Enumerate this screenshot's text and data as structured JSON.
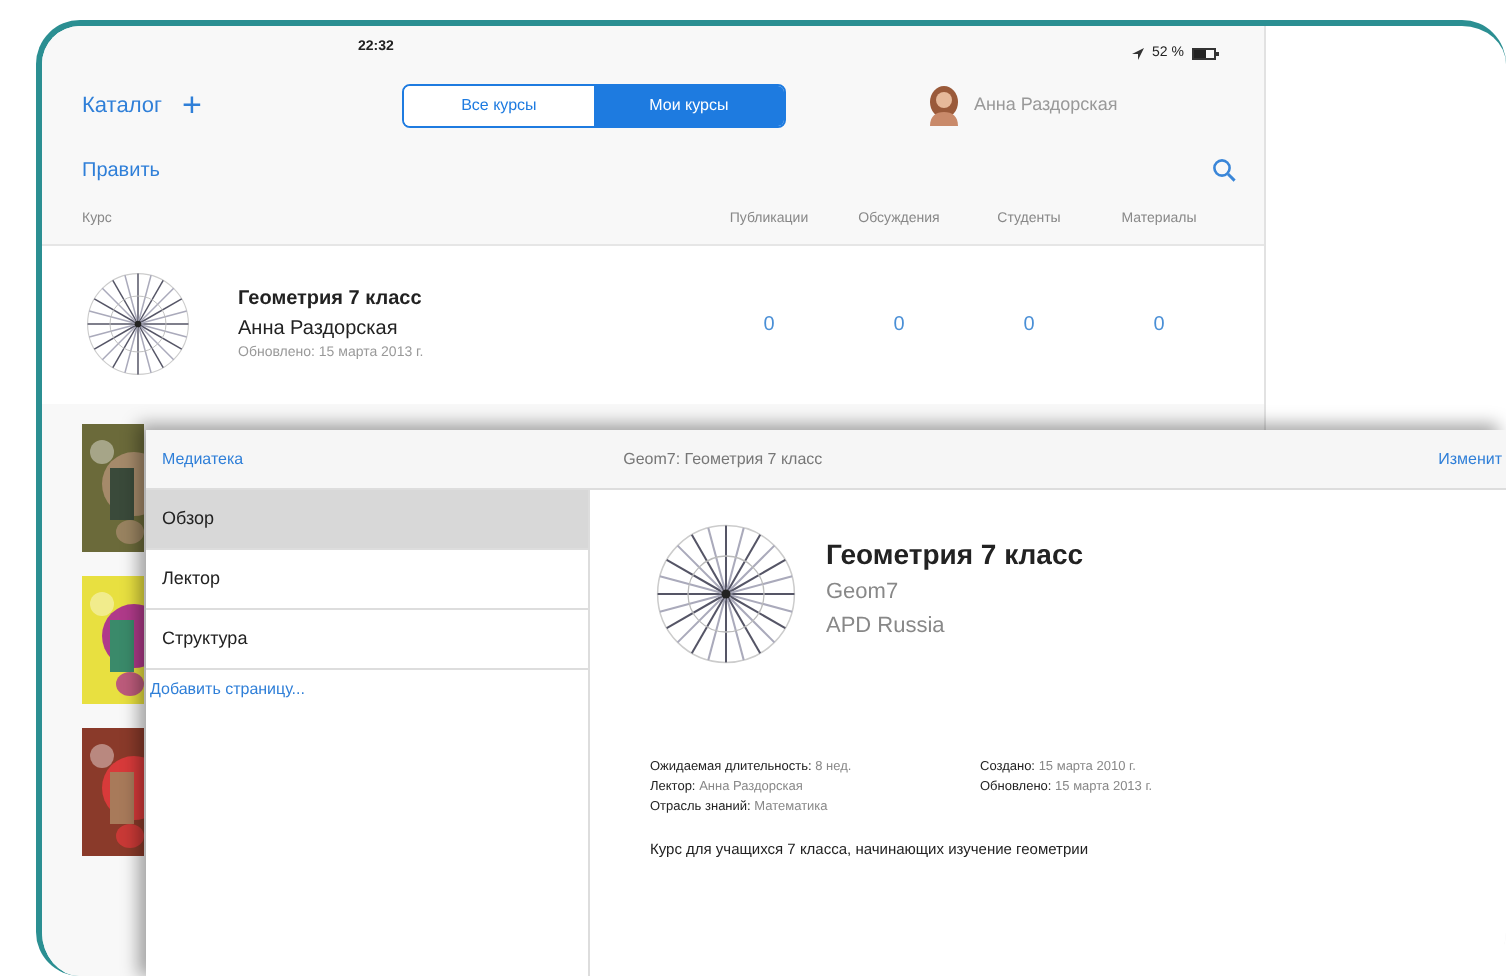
{
  "status_bar": {
    "time": "22:32",
    "battery": "52 %"
  },
  "toolbar": {
    "catalog": "Каталог",
    "add": "+",
    "segments": [
      {
        "label": "Все курсы",
        "selected": false
      },
      {
        "label": "Мои курсы",
        "selected": true
      }
    ],
    "user": "Анна Раздорская"
  },
  "edit": "Править",
  "table": {
    "columns": [
      "Курс",
      "Публикации",
      "Обсуждения",
      "Студенты",
      "Материалы"
    ],
    "rows": [
      {
        "title": "Геометрия 7 класс",
        "author": "Анна Раздорская",
        "updated": "Обновлено: 15 марта 2013 г.",
        "values": [
          "0",
          "0",
          "0",
          "0"
        ]
      }
    ]
  },
  "modal": {
    "back": "Медиатека",
    "title": "Geom7: Геометрия 7 класс",
    "action": "Изменит",
    "sidebar": [
      {
        "label": "Обзор",
        "selected": true
      },
      {
        "label": "Лектор",
        "selected": false
      },
      {
        "label": "Структура",
        "selected": false
      }
    ],
    "add_page": "Добавить страницу...",
    "course": {
      "title": "Геометрия 7 класс",
      "code": "Geom7",
      "org": "APD Russia",
      "details_left": [
        {
          "label": "Ожидаемая длительность:",
          "value": "8 нед."
        },
        {
          "label": "Лектор:",
          "value": "Анна Раздорская"
        },
        {
          "label": "Отрасль знаний:",
          "value": "Математика"
        }
      ],
      "details_right": [
        {
          "label": "Создано:",
          "value": "15 марта 2010 г."
        },
        {
          "label": "Обновлено:",
          "value": "15 марта 2013 г."
        }
      ],
      "description": "Курс для учащихся 7 класса, начинающих изучение геометрии"
    }
  }
}
